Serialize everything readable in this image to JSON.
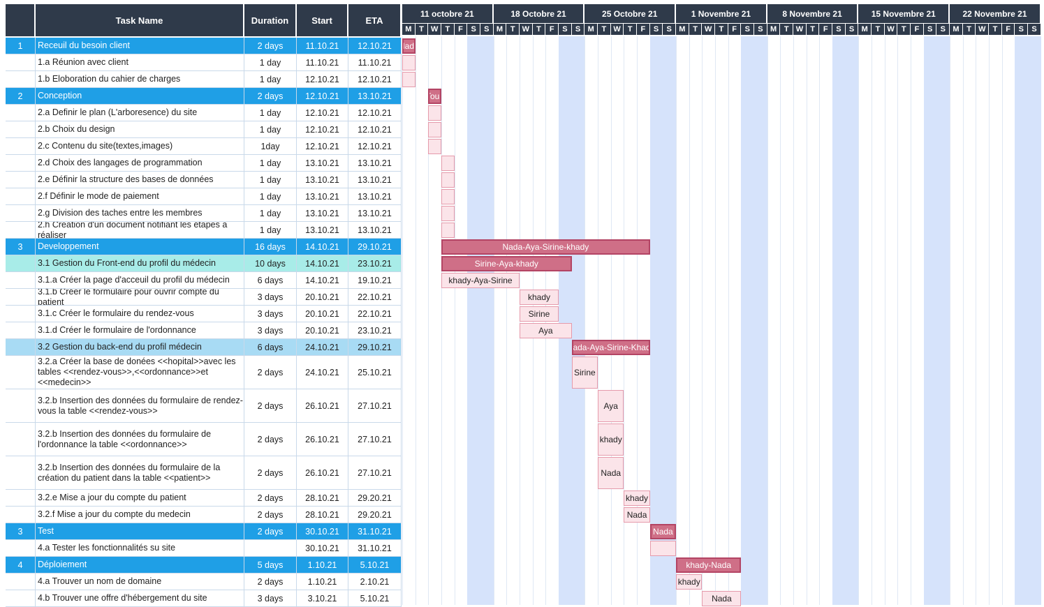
{
  "headers": {
    "num": "",
    "task": "Task Name",
    "duration": "Duration",
    "start": "Start",
    "eta": "ETA"
  },
  "weeks": [
    "11 octobre 21",
    "18 Octobre 21",
    "25 Octobre 21",
    "1 Novembre 21",
    "8 Novembre 21",
    "15 Novembre 21",
    "22 Novembre 21"
  ],
  "day_letters": [
    "M",
    "T",
    "W",
    "T",
    "F",
    "S",
    "S"
  ],
  "colors": {
    "header": "#2f3a4a",
    "phase": "#1f9fe6",
    "sub": "#a8dbf4",
    "subcyan": "#a8ece8",
    "weekend": "#d6e3fb",
    "bar_dark": "#cf6f87",
    "bar_light": "#fbe4e9"
  },
  "tasks": [
    {
      "num": "1",
      "name": "Receuil du besoin client",
      "duration": "2 days",
      "start": "11.10.21",
      "eta": "12.10.21",
      "kind": "phase",
      "bar": {
        "day": 0,
        "len": 1,
        "label": "Nada",
        "style": "dark"
      }
    },
    {
      "num": "",
      "name": "1.a Réunion avec client",
      "duration": "1 day",
      "start": "11.10.21",
      "eta": "11.10.21",
      "kind": "normal",
      "bar": {
        "day": 0,
        "len": 1,
        "label": "",
        "style": "light"
      }
    },
    {
      "num": "",
      "name": "1.b Eloboration du cahier de charges",
      "duration": "1 day",
      "start": "12.10.21",
      "eta": "12.10.21",
      "kind": "normal",
      "bar": {
        "day": 0,
        "len": 1,
        "label": "",
        "style": "light"
      }
    },
    {
      "num": "2",
      "name": "Conception",
      "duration": "2 days",
      "start": "12.10.21",
      "eta": "13.10.21",
      "kind": "phase",
      "bar": {
        "day": 2,
        "len": 1,
        "label": "Tous",
        "style": "dark"
      }
    },
    {
      "num": "",
      "name": "2.a Definir le plan (L'arboresence) du site",
      "duration": "1 day",
      "start": "12.10.21",
      "eta": "12.10.21",
      "kind": "normal",
      "bar": {
        "day": 2,
        "len": 1,
        "label": "",
        "style": "light"
      }
    },
    {
      "num": "",
      "name": "2.b Choix du design",
      "duration": "1 day",
      "start": "12.10.21",
      "eta": "12.10.21",
      "kind": "normal",
      "bar": {
        "day": 2,
        "len": 1,
        "label": "",
        "style": "light"
      }
    },
    {
      "num": "",
      "name": "2.c Contenu du site(textes,images)",
      "duration": "1day",
      "start": "12.10.21",
      "eta": "12.10.21",
      "kind": "normal",
      "bar": {
        "day": 2,
        "len": 1,
        "label": "",
        "style": "light"
      }
    },
    {
      "num": "",
      "name": "2.d Choix des langages de programmation",
      "duration": "1 day",
      "start": "13.10.21",
      "eta": "13.10.21",
      "kind": "normal",
      "bar": {
        "day": 3,
        "len": 1,
        "label": "",
        "style": "light"
      }
    },
    {
      "num": "",
      "name": "2.e Définir la structure des bases de données",
      "duration": "1 day",
      "start": "13.10.21",
      "eta": "13.10.21",
      "kind": "normal",
      "bar": {
        "day": 3,
        "len": 1,
        "label": "",
        "style": "light"
      }
    },
    {
      "num": "",
      "name": "2.f Définir le mode de paiement",
      "duration": "1 day",
      "start": "13.10.21",
      "eta": "13.10.21",
      "kind": "normal",
      "bar": {
        "day": 3,
        "len": 1,
        "label": "",
        "style": "light"
      }
    },
    {
      "num": "",
      "name": "2.g Division des taches entre les membres",
      "duration": "1 day",
      "start": "13.10.21",
      "eta": "13.10.21",
      "kind": "normal",
      "bar": {
        "day": 3,
        "len": 1,
        "label": "",
        "style": "light"
      }
    },
    {
      "num": "",
      "name": "2.h Creation d'un document notifiant les étapes a réaliser",
      "duration": "1 day",
      "start": "13.10.21",
      "eta": "13.10.21",
      "kind": "normal",
      "bar": {
        "day": 3,
        "len": 1,
        "label": "",
        "style": "light"
      }
    },
    {
      "num": "3",
      "name": "Developpement",
      "duration": "16 days",
      "start": "14.10.21",
      "eta": "29.10.21",
      "kind": "phase",
      "bar": {
        "day": 3,
        "len": 16,
        "label": "Nada-Aya-Sirine-khady",
        "style": "dark"
      }
    },
    {
      "num": "",
      "name": "3.1 Gestion du Front-end du profil du médecin",
      "duration": "10 days",
      "start": "14.10.21",
      "eta": "23.10.21",
      "kind": "subcyan",
      "bar": {
        "day": 3,
        "len": 10,
        "label": "Sirine-Aya-khady",
        "style": "dark"
      }
    },
    {
      "num": "",
      "name": "3.1.a Créer la page d'acceuil du profil du médecin",
      "duration": "6 days",
      "start": "14.10.21",
      "eta": "19.10.21",
      "kind": "normal",
      "bar": {
        "day": 3,
        "len": 6,
        "label": "khady-Aya-Sirine",
        "style": "light"
      }
    },
    {
      "num": "",
      "name": "3.1.b Créer le formulaire pour ouvrir  compte du patient",
      "duration": "3 days",
      "start": "20.10.21",
      "eta": "22.10.21",
      "kind": "normal",
      "bar": {
        "day": 9,
        "len": 3,
        "label": "khady",
        "style": "light"
      }
    },
    {
      "num": "",
      "name": "3.1.c  Créer le formulaire du rendez-vous",
      "duration": "3 days",
      "start": "20.10.21",
      "eta": "22.10.21",
      "kind": "normal",
      "bar": {
        "day": 9,
        "len": 3,
        "label": "Sirine",
        "style": "light"
      }
    },
    {
      "num": "",
      "name": "3.1.d Créer le formulaire de l'ordonnance",
      "duration": "3 days",
      "start": "20.10.21",
      "eta": "23.10.21",
      "kind": "normal",
      "bar": {
        "day": 9,
        "len": 4,
        "label": "Aya",
        "style": "light"
      }
    },
    {
      "num": "",
      "name": "3.2 Gestion du back-end du profil médecin",
      "duration": "6 days",
      "start": "24.10.21",
      "eta": "29.10.21",
      "kind": "sub",
      "bar": {
        "day": 13,
        "len": 6,
        "label": "Nada-Aya-Sirine-Khady",
        "style": "dark"
      }
    },
    {
      "num": "",
      "name": "3.2.a Créer la base de donées <<hopital>>avec les tables <<rendez-vous>>,<<ordonnance>>et <<medecin>>",
      "duration": "2 days",
      "start": "24.10.21",
      "eta": "25.10.21",
      "kind": "normal",
      "bar": {
        "day": 13,
        "len": 2,
        "label": "Sirine",
        "style": "light"
      }
    },
    {
      "num": "",
      "name": "3.2.b Insertion des données du formulaire de rendez-vous la table <<rendez-vous>>",
      "duration": "2 days",
      "start": "26.10.21",
      "eta": "27.10.21",
      "kind": "normal",
      "bar": {
        "day": 15,
        "len": 2,
        "label": "Aya",
        "style": "light"
      }
    },
    {
      "num": "",
      "name": "3.2.b Insertion des données du formulaire de l'ordonnance la table <<ordonnance>>",
      "duration": "2 days",
      "start": "26.10.21",
      "eta": "27.10.21",
      "kind": "normal",
      "bar": {
        "day": 15,
        "len": 2,
        "label": "khady",
        "style": "light"
      }
    },
    {
      "num": "",
      "name": "3.2.b Insertion des données du formulaire de la création du patient dans la table <<patient>>",
      "duration": "2 days",
      "start": "26.10.21",
      "eta": "27.10.21",
      "kind": "normal",
      "bar": {
        "day": 15,
        "len": 2,
        "label": "Nada",
        "style": "light"
      }
    },
    {
      "num": "",
      "name": "3.2.e Mise a jour du compte du patient",
      "duration": "2 days",
      "start": "28.10.21",
      "eta": "29.20.21",
      "kind": "normal",
      "bar": {
        "day": 17,
        "len": 2,
        "label": "khady",
        "style": "light"
      }
    },
    {
      "num": "",
      "name": "3.2.f Mise a jour du compte du medecin",
      "duration": "2 days",
      "start": "28.10.21",
      "eta": "29.20.21",
      "kind": "normal",
      "bar": {
        "day": 17,
        "len": 2,
        "label": "Nada",
        "style": "light"
      }
    },
    {
      "num": "3",
      "name": "Test",
      "duration": "2 days",
      "start": "30.10.21",
      "eta": "31.10.21",
      "kind": "phase",
      "bar": {
        "day": 19,
        "len": 2,
        "label": "Nada",
        "style": "dark"
      }
    },
    {
      "num": "",
      "name": "4.a Tester les fonctionnalités su site",
      "duration": "",
      "start": "30.10.21",
      "eta": "31.10.21",
      "kind": "normal",
      "bar": {
        "day": 19,
        "len": 2,
        "label": "",
        "style": "light"
      }
    },
    {
      "num": "4",
      "name": "Déploiement",
      "duration": "5 days",
      "start": "1.10.21",
      "eta": "5.10.21",
      "kind": "phase",
      "bar": {
        "day": 21,
        "len": 5,
        "label": "khady-Nada",
        "style": "dark"
      }
    },
    {
      "num": "",
      "name": "4.a Trouver un nom de domaine",
      "duration": "2 days",
      "start": "1.10.21",
      "eta": "2.10.21",
      "kind": "normal",
      "bar": {
        "day": 21,
        "len": 2,
        "label": "khady",
        "style": "light"
      }
    },
    {
      "num": "",
      "name": "4.b Trouver une offre d'hébergement du site",
      "duration": "3 days",
      "start": "3.10.21",
      "eta": "5.10.21",
      "kind": "normal",
      "bar": {
        "day": 23,
        "len": 3,
        "label": "Nada",
        "style": "light"
      }
    }
  ]
}
